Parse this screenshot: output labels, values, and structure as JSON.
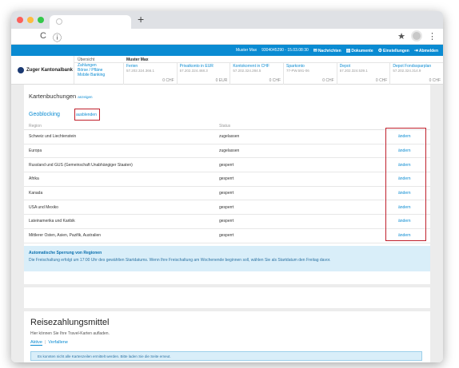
{
  "browser": {
    "new_tab_icon": "+",
    "reload_icon": "C",
    "info_icon": "ⓘ",
    "bookmark_icon": "★",
    "menu_icon": "⋮"
  },
  "app": {
    "top": {
      "user": "Muster Max",
      "session": "9304045290 - 15.03.08:30",
      "nachrichten": "Nachrichten",
      "dokumente": "Dokumente",
      "einstellungen": "Einstellungen",
      "abmelden": "Abmelden"
    },
    "logo": "Zuger Kantonalbank",
    "menu": {
      "head": "Übersicht",
      "items": [
        "Zahlungen",
        "Börse / Pfläne",
        "Mobile Banking"
      ]
    },
    "owner": "Muster Max",
    "accounts": [
      {
        "name": "Ferien",
        "num": "57.202.324.366.1",
        "amount": "0",
        "cur": "CHF"
      },
      {
        "name": "Privatkonto in EUR",
        "num": "57.202.324.468.3",
        "amount": "0",
        "cur": "EUR"
      },
      {
        "name": "Kontokorrent in CHF",
        "num": "57.202.324.284.5",
        "amount": "0",
        "cur": "CHF"
      },
      {
        "name": "Sparkonto",
        "num": "77-PW.591-06",
        "amount": "0",
        "cur": "CHF"
      },
      {
        "name": "Depot",
        "num": "57.202.324.539.1",
        "amount": "0",
        "cur": "CHF"
      },
      {
        "name": "Depot Fondssparplan",
        "num": "57.202.324.314.9",
        "amount": "0",
        "cur": "CHF"
      }
    ]
  },
  "kartenbuchungen": {
    "title": "Kartenbuchungen",
    "link": "anzeigen"
  },
  "geoblocking": {
    "title": "Geoblocking",
    "hide": "ausblenden",
    "headers": {
      "region": "Region",
      "status": "Status"
    },
    "rows": [
      {
        "region": "Schweiz und Liechtenstein",
        "status": "zugelassen",
        "action": "ändern"
      },
      {
        "region": "Europa",
        "status": "zugelassen",
        "action": "ändern"
      },
      {
        "region": "Russland und GUS (Gemeinschaft Unabhängiger Staaten)",
        "status": "gesperrt",
        "action": "ändern"
      },
      {
        "region": "Afrika",
        "status": "gesperrt",
        "action": "ändern"
      },
      {
        "region": "Kanada",
        "status": "gesperrt",
        "action": "ändern"
      },
      {
        "region": "USA und Mexiko",
        "status": "gesperrt",
        "action": "ändern"
      },
      {
        "region": "Lateinamerika und Karibik",
        "status": "gesperrt",
        "action": "ändern"
      },
      {
        "region": "Mittlerer Osten, Asien, Pazifik, Australien",
        "status": "gesperrt",
        "action": "ändern"
      }
    ],
    "info_title": "Automatische Sperrung von Regionen",
    "info_text": "Die Freischaltung erfolgt um 17:00 Uhr des gewählten Startdatums. Wenn Ihre Freischaltung am Wochenende beginnen soll, wählen Sie als Startdatum den Freitag davor."
  },
  "reisezahlungsmittel": {
    "title": "Reisezahlungsmittel",
    "subtitle": "Hier können Sie Ihre Travel-Karten aufladen.",
    "tab_active": "Aktive",
    "tab_inactive": "Verfallene",
    "alert": "Es konnten nicht alle Kartenzeilen ermittelt werden. Bitte laden Sie die Seite erneut."
  }
}
